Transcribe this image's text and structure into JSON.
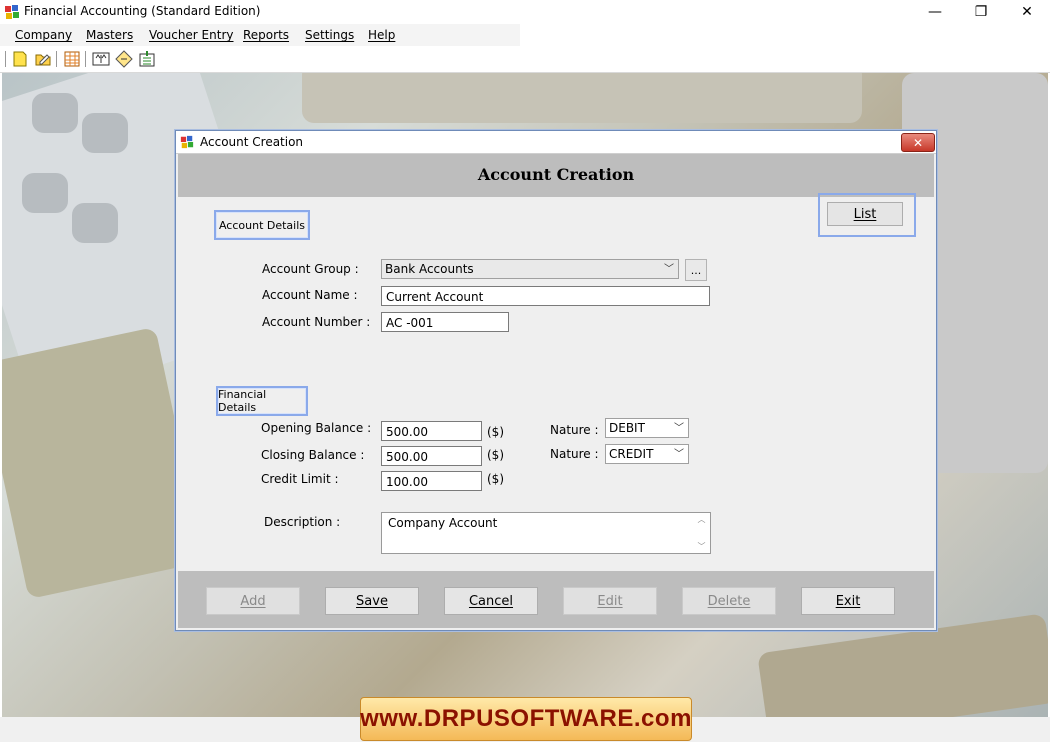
{
  "window": {
    "title": "Financial Accounting (Standard Edition)",
    "minimize": "—",
    "maximize": "❐",
    "close": "✕"
  },
  "menu": [
    "Company",
    "Masters",
    "Voucher Entry",
    "Reports",
    "Settings",
    "Help"
  ],
  "toolbar": [
    "new-icon",
    "open-icon",
    "grid-icon",
    "balance-icon",
    "voucher-icon",
    "export-icon"
  ],
  "dialog": {
    "title": "Account Creation",
    "heading": "Account Creation",
    "close_glyph": "✕",
    "list_button": "List",
    "account_details_label": "Account Details",
    "financial_details_label": "Financial Details",
    "account_group": {
      "label": "Account Group :",
      "value": "Bank Accounts",
      "browse": "..."
    },
    "account_name": {
      "label": "Account Name :",
      "value": "Current Account"
    },
    "account_number": {
      "label": "Account Number :",
      "value": "AC -001"
    },
    "opening_balance": {
      "label": "Opening Balance :",
      "value": "500.00",
      "unit": "($)",
      "nature_label": "Nature :",
      "nature": "DEBIT"
    },
    "closing_balance": {
      "label": "Closing Balance :",
      "value": "500.00",
      "unit": "($)",
      "nature_label": "Nature :",
      "nature": "CREDIT"
    },
    "credit_limit": {
      "label": "Credit Limit :",
      "value": "100.00",
      "unit": "($)"
    },
    "description": {
      "label": "Description :",
      "value": "Company Account"
    },
    "buttons": {
      "add": "Add",
      "save": "Save",
      "cancel": "Cancel",
      "edit": "Edit",
      "delete": "Delete",
      "exit": "Exit"
    }
  },
  "brand": "www.DRPUSOFTWARE.com"
}
